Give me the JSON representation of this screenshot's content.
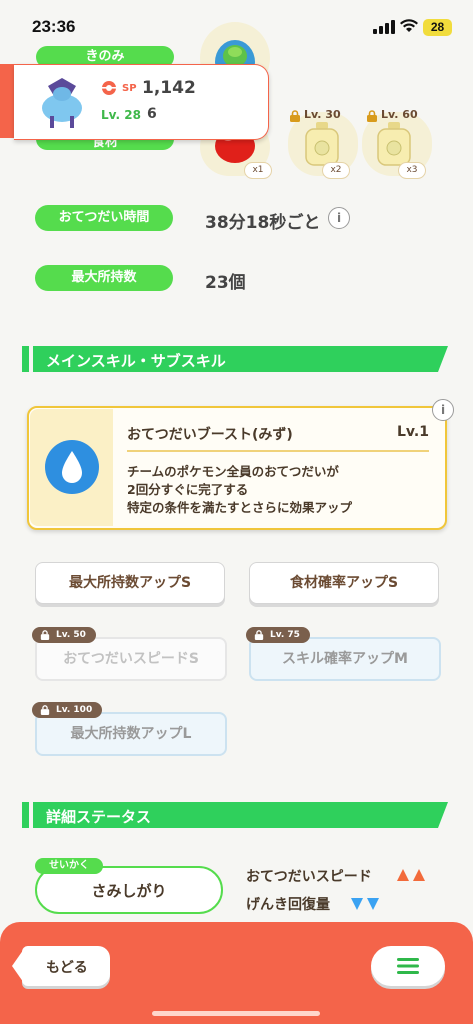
{
  "status_bar": {
    "time": "23:36",
    "battery": "28"
  },
  "header_pills": {
    "berry": "きのみ",
    "ingredient": "食材"
  },
  "pokemon": {
    "sp_label": "SP",
    "sp_value": "1,142",
    "level": "Lv. 28",
    "number": "6"
  },
  "ingredients": [
    {
      "lock_label": "",
      "quantity": "x1"
    },
    {
      "lock_label": "Lv. 30",
      "quantity": "x2"
    },
    {
      "lock_label": "Lv. 60",
      "quantity": "x3"
    }
  ],
  "stats": {
    "help_time_label": "おてつだい時間",
    "help_time_value": "38分18秒ごと",
    "max_carry_label": "最大所持数",
    "max_carry_value": "23個"
  },
  "main_skill_section": {
    "title": "メインスキル・サブスキル"
  },
  "main_skill": {
    "name": "おてつだいブースト(みず)",
    "level": "Lv.1",
    "desc1": "チームのポケモン全員のおてつだいが",
    "desc2": "2回分すぐに完了する",
    "desc3": "特定の条件を満たすとさらに効果アップ"
  },
  "sub_skills": [
    {
      "label": "最大所持数アップS",
      "lock": ""
    },
    {
      "label": "食材確率アップS",
      "lock": ""
    },
    {
      "label": "おてつだいスピードS",
      "lock": "Lv. 50"
    },
    {
      "label": "スキル確率アップM",
      "lock": "Lv. 75"
    },
    {
      "label": "最大所持数アップL",
      "lock": "Lv. 100"
    }
  ],
  "detail_section": {
    "title": "詳細ステータス"
  },
  "nature": {
    "tag": "せいかく",
    "value": "さみしがり",
    "up_label": "おてつだいスピード",
    "down_label": "げんき回復量",
    "up_color": "#f26a3a",
    "down_color": "#3aa2f2"
  },
  "bottom_bar": {
    "back_label": "もどる"
  },
  "colors": {
    "accent_green": "#55dc4d",
    "banner_green": "#2fd05c",
    "bottom_bar": "#f4644a"
  }
}
